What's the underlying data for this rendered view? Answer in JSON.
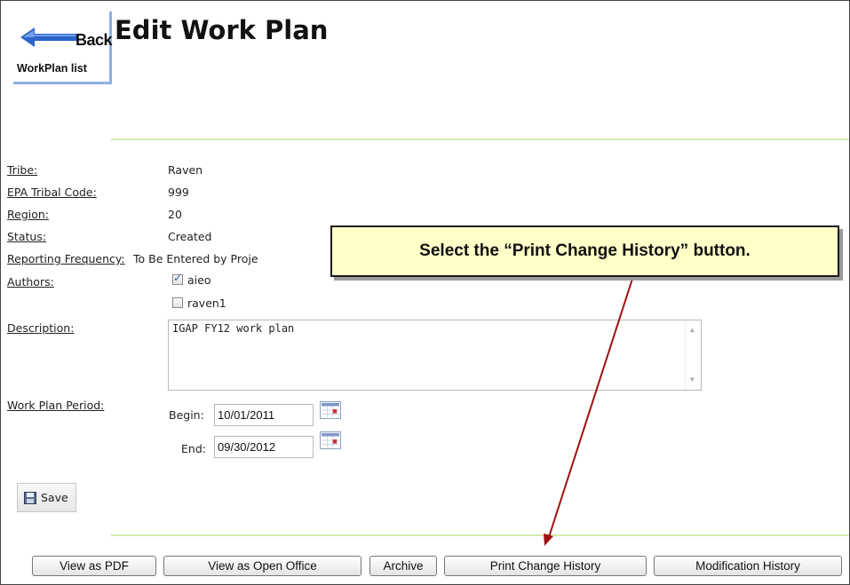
{
  "back": {
    "label": "Back",
    "sublabel": "WorkPlan list"
  },
  "page_title": "Edit Work Plan",
  "fields": {
    "tribe": {
      "label": "Tribe:",
      "value": "Raven"
    },
    "epa_code": {
      "label": "EPA Tribal Code:",
      "value": "999"
    },
    "region": {
      "label": "Region:",
      "value": "20"
    },
    "status": {
      "label": "Status:",
      "value": "Created"
    },
    "reporting": {
      "label": "Reporting Frequency:",
      "value": "To Be Entered by Proje"
    },
    "authors": {
      "label": "Authors:",
      "items": [
        {
          "name": "aieo",
          "checked": true
        },
        {
          "name": "raven1",
          "checked": false
        }
      ]
    },
    "description": {
      "label": "Description:",
      "value": "IGAP FY12 work plan"
    },
    "period": {
      "label": "Work Plan Period:",
      "begin_label": "Begin:",
      "begin_value": "10/01/2011",
      "end_label": "End:",
      "end_value": "09/30/2012"
    }
  },
  "save_label": "Save",
  "buttons": {
    "pdf": "View as PDF",
    "open_office": "View as Open Office",
    "archive": "Archive",
    "print_history": "Print Change History",
    "mod_history": "Modification History"
  },
  "callout_text": "Select the “Print Change History” button.",
  "colors": {
    "callout_bg": "#ffffc8",
    "arrow": "#a01010",
    "rule": "#d6ebb0",
    "back_arrow": "#2d64c8"
  }
}
